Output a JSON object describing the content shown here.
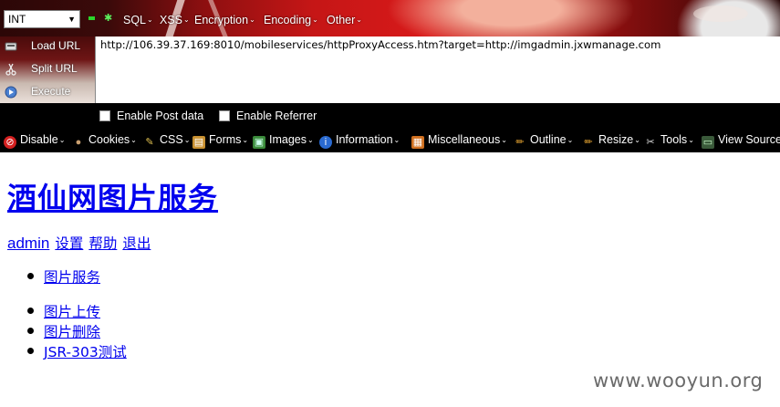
{
  "hackbar": {
    "type_select": {
      "value": "INT",
      "arrow": "▼"
    },
    "buttons": {
      "dash": "–",
      "star": "✱"
    },
    "menus": [
      {
        "label": "SQL"
      },
      {
        "label": "XSS"
      },
      {
        "label": "Encryption"
      },
      {
        "label": "Encoding"
      },
      {
        "label": "Other"
      }
    ],
    "side": {
      "load_url": "Load URL",
      "split_url": "Split URL",
      "execute": "Execute"
    },
    "url": "http://106.39.37.169:8010/mobileservices/httpProxyAccess.htm?target=http://imgadmin.jxwmanage.com",
    "enable_post": "Enable Post data",
    "enable_referrer": "Enable Referrer"
  },
  "webdev_toolbar": {
    "items": [
      {
        "label": "Disable",
        "icon": "disable-icon",
        "color": "#d42020"
      },
      {
        "label": "Cookies",
        "icon": "cookies-icon",
        "color": "#8a6a40"
      },
      {
        "label": "CSS",
        "icon": "css-icon",
        "color": "#d8b040"
      },
      {
        "label": "Forms",
        "icon": "forms-icon",
        "color": "#c89030"
      },
      {
        "label": "Images",
        "icon": "images-icon",
        "color": "#3a8a3a"
      },
      {
        "label": "Information",
        "icon": "information-icon",
        "color": "#2a6ad0"
      },
      {
        "label": "Miscellaneous",
        "icon": "miscellaneous-icon",
        "color": "#d07020"
      },
      {
        "label": "Outline",
        "icon": "outline-icon",
        "color": "#e0a030"
      },
      {
        "label": "Resize",
        "icon": "resize-icon",
        "color": "#e0a030"
      },
      {
        "label": "Tools",
        "icon": "tools-icon",
        "color": "#bbbbbb"
      },
      {
        "label": "View Source",
        "icon": "view-source-icon",
        "color": "#5a8a5a"
      }
    ],
    "chev": "⌄"
  },
  "page": {
    "title": "酒仙网图片服务",
    "user_links": [
      "admin",
      "设置",
      "帮助",
      "退出"
    ],
    "nav_group1": [
      "图片服务"
    ],
    "nav_group2": [
      "图片上传",
      "图片删除",
      "JSR-303测试"
    ]
  },
  "watermark": "www.wooyun.org",
  "colors": {
    "link": "#0000ee",
    "toolbar_bg": "#000000",
    "banner_red": "#c51616"
  }
}
